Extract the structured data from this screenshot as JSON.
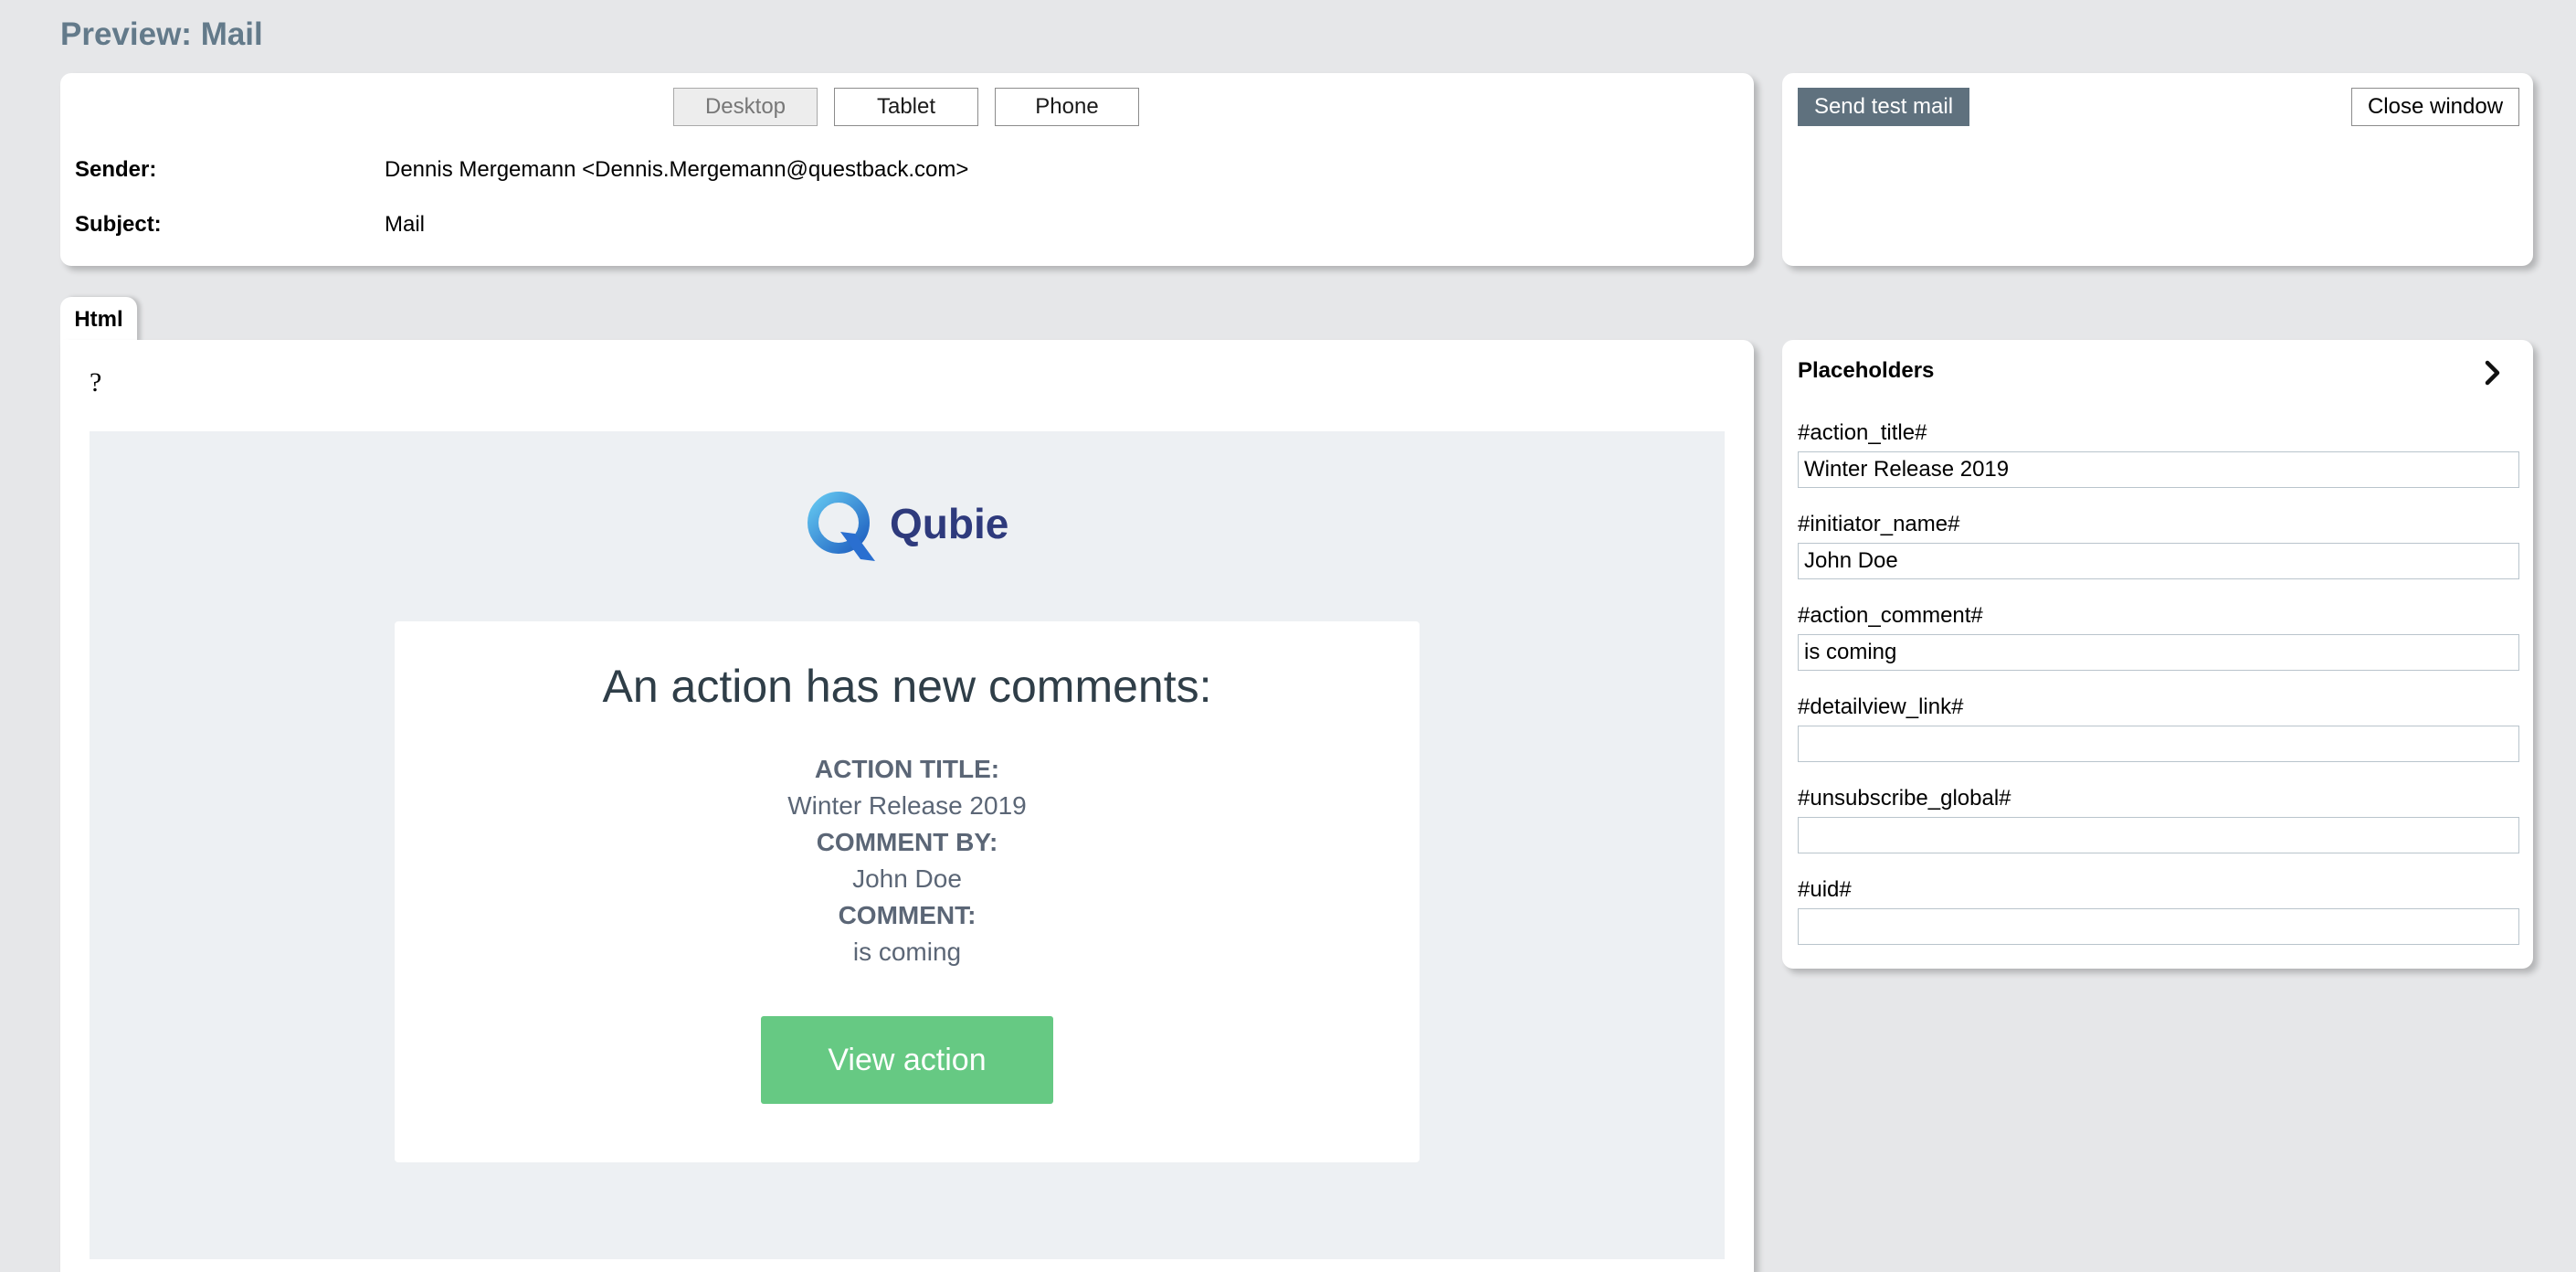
{
  "page": {
    "title": "Preview: Mail"
  },
  "view_toggle": {
    "desktop": "Desktop",
    "tablet": "Tablet",
    "phone": "Phone",
    "active": "Desktop"
  },
  "header": {
    "sender_label": "Sender:",
    "sender_value": "Dennis Mergemann <Dennis.Mergemann@questback.com>",
    "subject_label": "Subject:",
    "subject_value": "Mail"
  },
  "actions": {
    "send_test_mail": "Send test mail",
    "close_window": "Close window"
  },
  "tabs": [
    {
      "label": "Html"
    }
  ],
  "preview": {
    "unknown_char": "?",
    "logo_text": "Qubie",
    "heading": "An action has new comments:",
    "action_title_label": "ACTION TITLE:",
    "action_title_value": "Winter Release 2019",
    "comment_by_label": "COMMENT BY:",
    "comment_by_value": "John Doe",
    "comment_label": "COMMENT:",
    "comment_value": "is coming",
    "button": "View action"
  },
  "placeholders": {
    "title": "Placeholders",
    "items": [
      {
        "label": "#action_title#",
        "value": "Winter Release 2019"
      },
      {
        "label": "#initiator_name#",
        "value": "John Doe"
      },
      {
        "label": "#action_comment#",
        "value": "is coming"
      },
      {
        "label": "#detailview_link#",
        "value": ""
      },
      {
        "label": "#unsubscribe_global#",
        "value": ""
      },
      {
        "label": "#uid#",
        "value": ""
      }
    ]
  },
  "colors": {
    "background": "#e6e7e9",
    "title": "#637a8a",
    "send_button": "#5f717e",
    "view_button": "#66c983",
    "logo_text": "#2e3a7c",
    "email_background": "#edf0f3"
  },
  "icons": {
    "placeholders_toggle": "chevron-right-icon",
    "logo": "qubie-logo-icon"
  }
}
